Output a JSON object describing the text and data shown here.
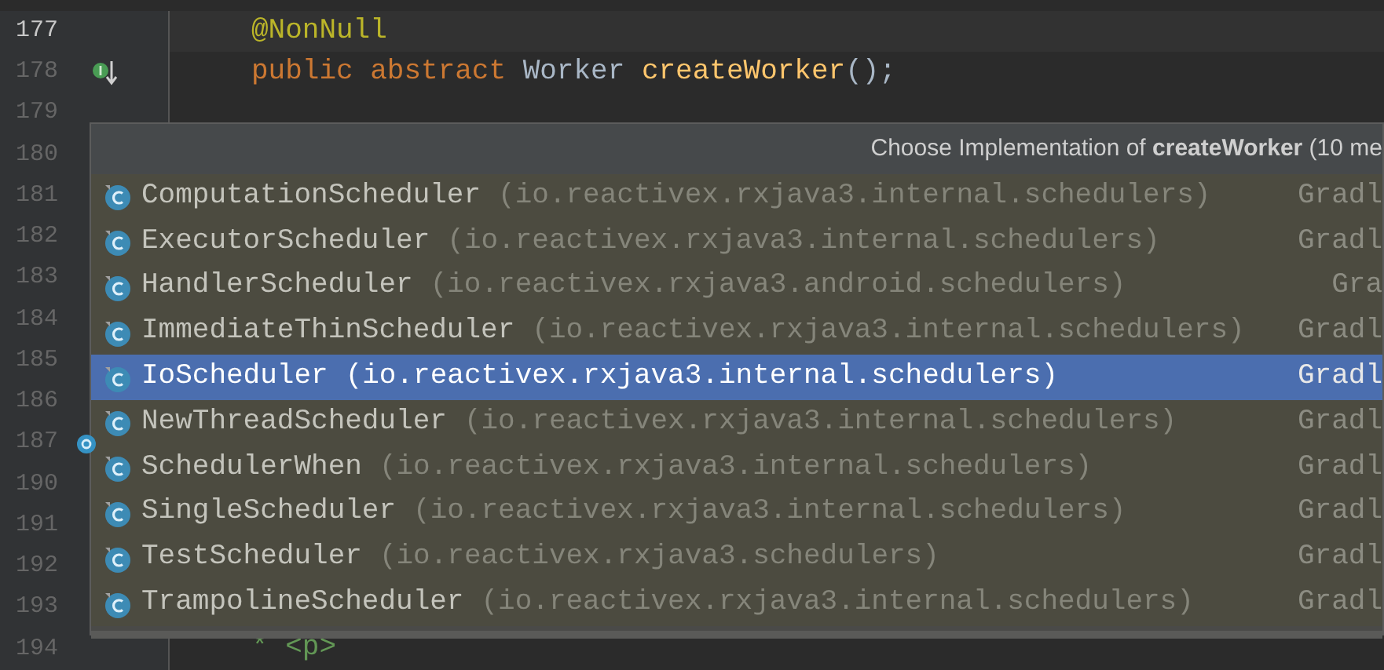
{
  "editor": {
    "lines": [
      {
        "number": "177",
        "current": true,
        "kind": "plain",
        "tokens": [
          {
            "kind": "annotation",
            "text": "@NonNull"
          }
        ]
      },
      {
        "number": "178",
        "current": false,
        "kind": "implemented",
        "tokens": [
          {
            "kind": "keyword",
            "text": "public abstract "
          },
          {
            "kind": "type",
            "text": "Worker "
          },
          {
            "kind": "method",
            "text": "createWorker"
          },
          {
            "kind": "plain",
            "text": "();"
          }
        ]
      },
      {
        "number": "179",
        "current": false,
        "kind": "plain"
      },
      {
        "number": "180",
        "current": false,
        "kind": "plain"
      },
      {
        "number": "181",
        "current": false,
        "kind": "plain"
      },
      {
        "number": "182",
        "current": false,
        "kind": "plain"
      },
      {
        "number": "183",
        "current": false,
        "kind": "plain"
      },
      {
        "number": "184",
        "current": false,
        "kind": "plain"
      },
      {
        "number": "185",
        "current": false,
        "kind": "plain"
      },
      {
        "number": "186",
        "current": false,
        "kind": "plain"
      },
      {
        "number": "187",
        "current": false,
        "kind": "override"
      },
      {
        "number": "190",
        "current": false,
        "kind": "plain"
      },
      {
        "number": "191",
        "current": false,
        "kind": "plain"
      },
      {
        "number": "192",
        "current": false,
        "kind": "plain"
      },
      {
        "number": "193",
        "current": false,
        "kind": "plain"
      },
      {
        "number": "194",
        "current": false,
        "kind": "plain",
        "tokens": [
          {
            "kind": "comment",
            "text": "* <p>"
          }
        ]
      }
    ]
  },
  "popup": {
    "title": "Choose Implementation of **createWorker** (10 me",
    "items": [
      {
        "name": "ComputationScheduler",
        "package": "(io.reactivex.rxjava3.internal.schedulers)",
        "module": "Gradl",
        "selected": false
      },
      {
        "name": "ExecutorScheduler",
        "package": "(io.reactivex.rxjava3.internal.schedulers)",
        "module": "Gradl",
        "selected": false
      },
      {
        "name": "HandlerScheduler",
        "package": "(io.reactivex.rxjava3.android.schedulers)",
        "module": "Gra",
        "selected": false
      },
      {
        "name": "ImmediateThinScheduler",
        "package": "(io.reactivex.rxjava3.internal.schedulers)",
        "module": "Gradl",
        "selected": false
      },
      {
        "name": "IoScheduler",
        "package": "(io.reactivex.rxjava3.internal.schedulers)",
        "module": "Gradl",
        "selected": true
      },
      {
        "name": "NewThreadScheduler",
        "package": "(io.reactivex.rxjava3.internal.schedulers)",
        "module": "Gradl",
        "selected": false
      },
      {
        "name": "SchedulerWhen",
        "package": "(io.reactivex.rxjava3.internal.schedulers)",
        "module": "Gradl",
        "selected": false
      },
      {
        "name": "SingleScheduler",
        "package": "(io.reactivex.rxjava3.internal.schedulers)",
        "module": "Gradl",
        "selected": false
      },
      {
        "name": "TestScheduler",
        "package": "(io.reactivex.rxjava3.schedulers)",
        "module": "Gradl",
        "selected": false
      },
      {
        "name": "TrampolineScheduler",
        "package": "(io.reactivex.rxjava3.internal.schedulers)",
        "module": "Gradl",
        "selected": false
      }
    ]
  }
}
